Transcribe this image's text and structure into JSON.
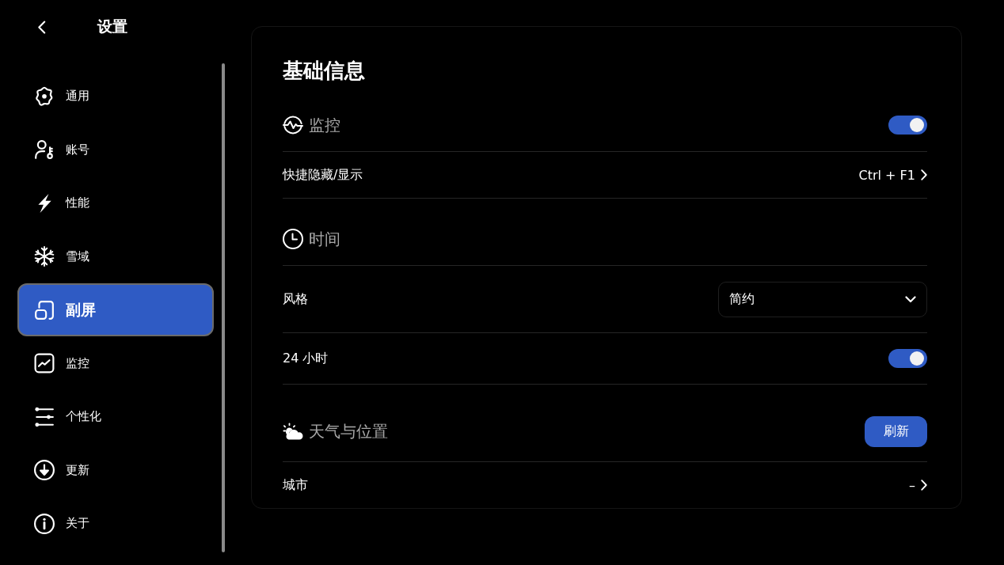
{
  "header": {
    "title": "设置"
  },
  "sidebar": {
    "items": [
      {
        "label": "通用",
        "selected": false
      },
      {
        "label": "账号",
        "selected": false
      },
      {
        "label": "性能",
        "selected": false
      },
      {
        "label": "雪域",
        "selected": false
      },
      {
        "label": "副屏",
        "selected": true
      },
      {
        "label": "监控",
        "selected": false
      },
      {
        "label": "个性化",
        "selected": false
      },
      {
        "label": "更新",
        "selected": false
      },
      {
        "label": "关于",
        "selected": false
      }
    ]
  },
  "panel": {
    "title": "基础信息",
    "sections": [
      {
        "title": "监控",
        "control": {
          "kind": "toggle",
          "on": true
        },
        "rows": [
          {
            "kind": "link",
            "label": "快捷隐藏/显示",
            "value": "Ctrl + F1"
          }
        ]
      },
      {
        "title": "时间",
        "rows": [
          {
            "kind": "select",
            "label": "风格",
            "value": "简约"
          },
          {
            "kind": "toggle",
            "label": "24 小时",
            "on": true
          }
        ]
      },
      {
        "title": "天气与位置",
        "control": {
          "kind": "button",
          "label": "刷新"
        },
        "rows": [
          {
            "kind": "link",
            "label": "城市",
            "value": "–"
          }
        ]
      }
    ]
  }
}
